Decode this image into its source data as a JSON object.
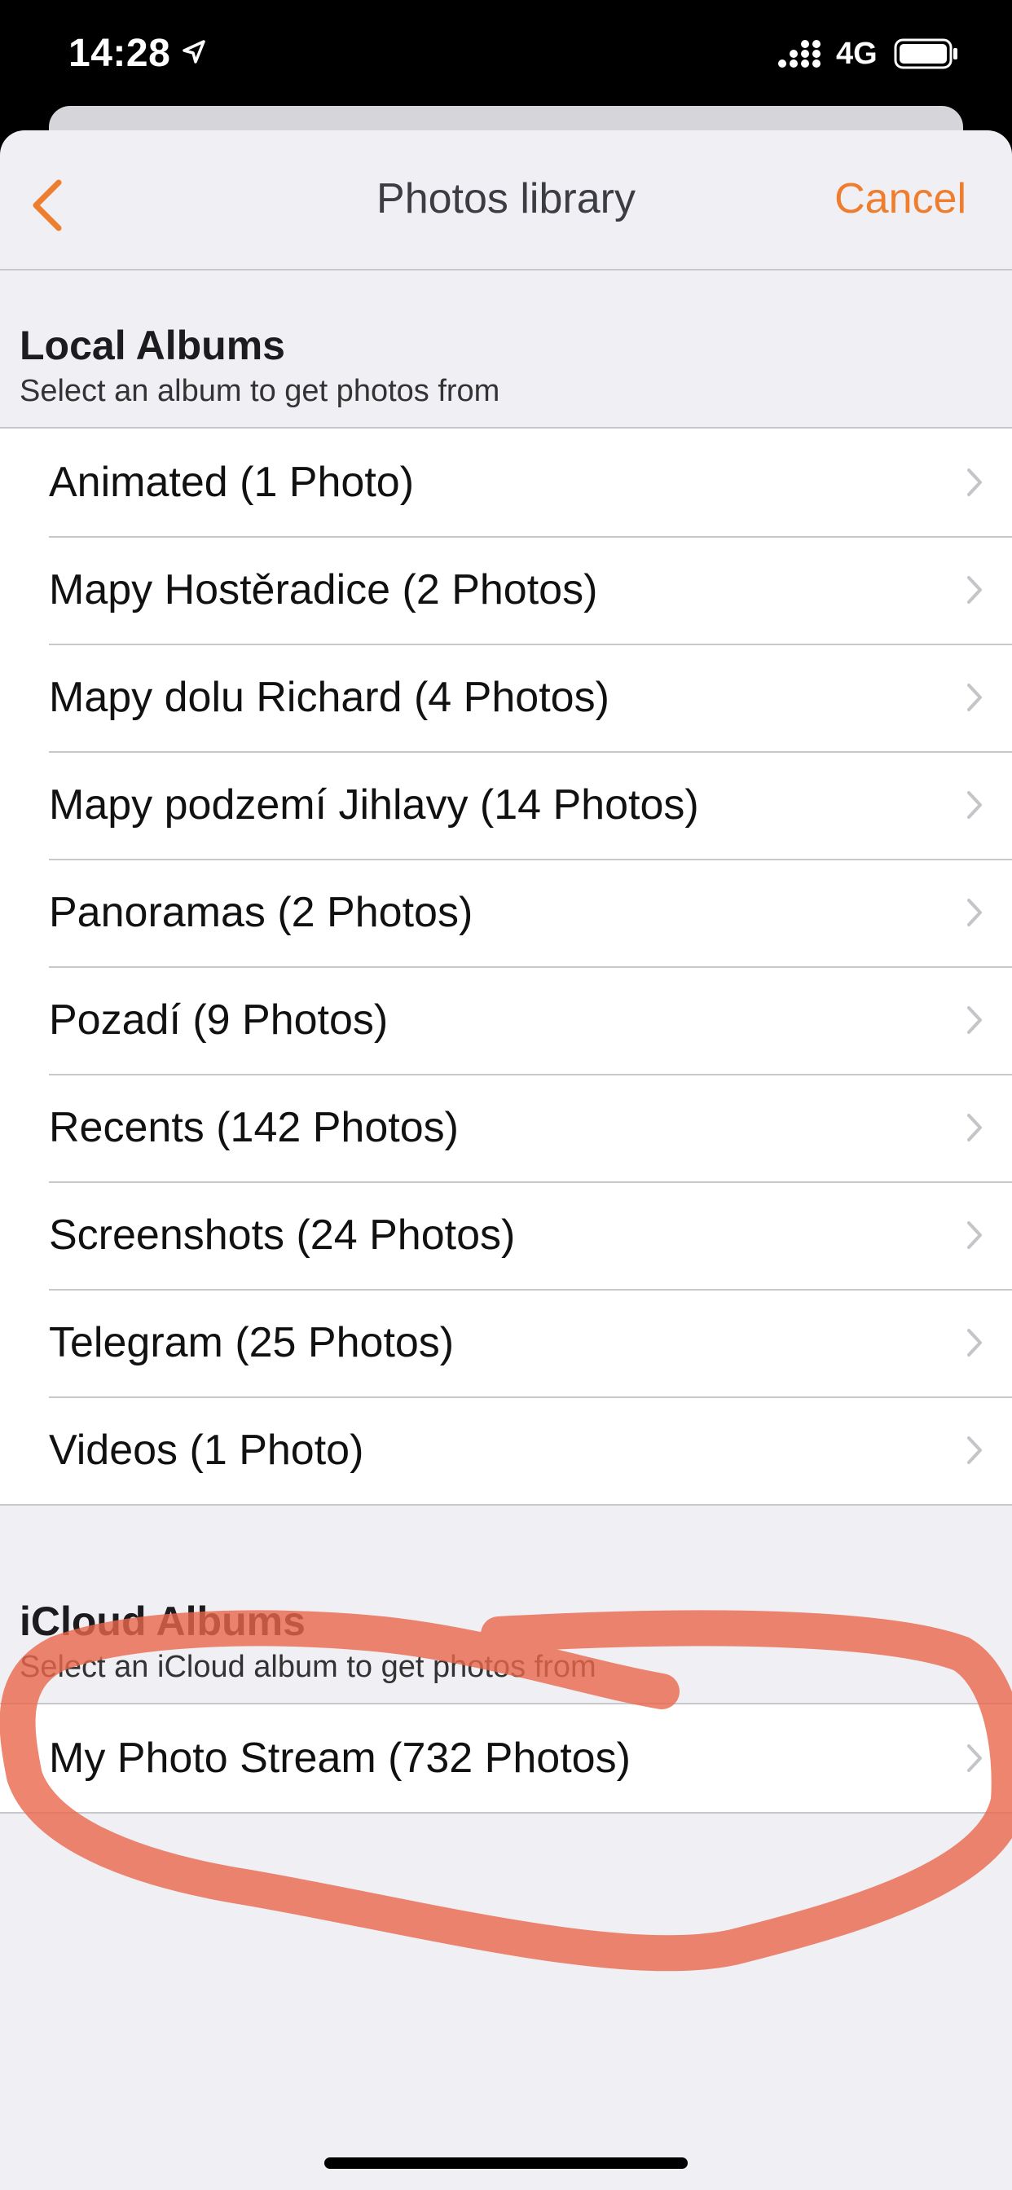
{
  "status_bar": {
    "time": "14:28",
    "network": "4G",
    "icons": [
      "location-arrow-icon",
      "signal-bars-icon",
      "battery-icon"
    ]
  },
  "nav": {
    "title": "Photos library",
    "cancel_label": "Cancel",
    "back_icon": "chevron-left-icon"
  },
  "local": {
    "title": "Local Albums",
    "subtitle": "Select an album to get photos from",
    "albums": [
      "Animated (1 Photo)",
      "Mapy Hostěradice (2 Photos)",
      "Mapy dolu Richard (4 Photos)",
      "Mapy podzemí Jihlavy (14 Photos)",
      "Panoramas (2 Photos)",
      "Pozadí (9 Photos)",
      "Recents (142 Photos)",
      "Screenshots (24 Photos)",
      "Telegram (25 Photos)",
      "Videos (1 Photo)"
    ]
  },
  "icloud": {
    "title": "iCloud Albums",
    "subtitle": "Select an iCloud album to get photos from",
    "albums": [
      "My Photo Stream (732 Photos)"
    ]
  },
  "colors": {
    "accent": "#ef7d2e",
    "background": "#efeff4",
    "annotation": "#e9674b"
  }
}
